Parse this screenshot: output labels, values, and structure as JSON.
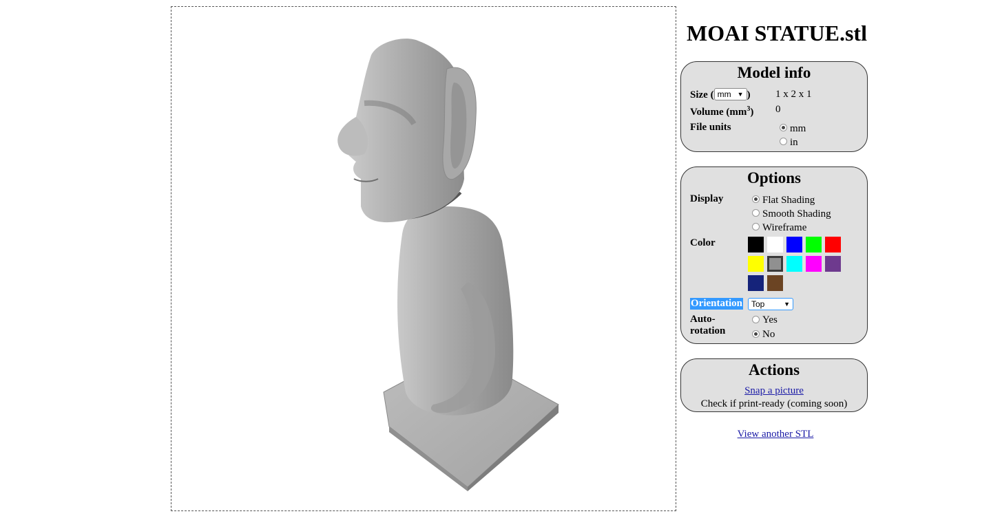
{
  "file_title": "MOAI STATUE.stl",
  "model_info": {
    "heading": "Model info",
    "size_label": "Size (",
    "size_label_close": ")",
    "size_unit_selected": "mm",
    "size_value": "1 x 2 x 1",
    "volume_label": "Volume (mm",
    "volume_sup": "3",
    "volume_label_close": ")",
    "volume_value": "0",
    "file_units_label": "File units",
    "file_units_options": [
      "mm",
      "in"
    ],
    "file_units_selected": "mm"
  },
  "options": {
    "heading": "Options",
    "display_label": "Display",
    "display_options": [
      "Flat Shading",
      "Smooth Shading",
      "Wireframe"
    ],
    "display_selected": "Flat Shading",
    "color_label": "Color",
    "colors": [
      "#000000",
      "#ffffff",
      "#0000ff",
      "#00ff00",
      "#ff0000",
      "#ffff00",
      "#909090",
      "#00ffff",
      "#ff00ff",
      "#6e3a8e",
      "#15237a",
      "#6b4423"
    ],
    "color_selected": "#909090",
    "orientation_label": "Orientation",
    "orientation_selected": "Top",
    "autorotation_label_1": "Auto-",
    "autorotation_label_2": "rotation",
    "autorotation_options": [
      "Yes",
      "No"
    ],
    "autorotation_selected": "No",
    "highlight_color": "#3399ff"
  },
  "actions": {
    "heading": "Actions",
    "snap_link": "Snap a picture",
    "print_ready_text": "Check if print-ready (coming soon)"
  },
  "view_another_link": "View another STL"
}
